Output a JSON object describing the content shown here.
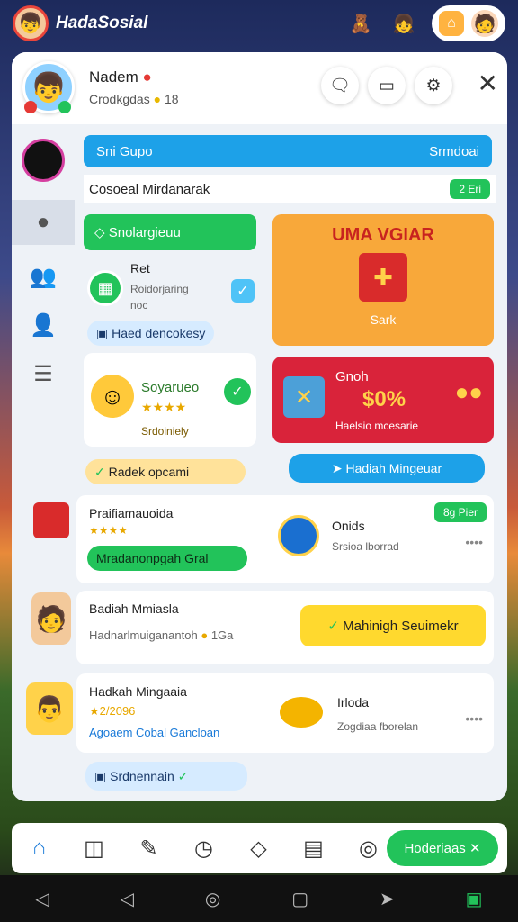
{
  "app": {
    "title": "HadaSosial"
  },
  "profile": {
    "name": "Nadem",
    "subtitle": "Crodkgdas",
    "coins": "18"
  },
  "sections": {
    "group_left": "Sni Gupo",
    "group_right": "Srmdoai",
    "community": "Cosoeal Mirdanarak",
    "community_badge": "2 Eri",
    "green_header": "Snolargieuu",
    "item_title": "Ret",
    "item_sub": "Roidorjaring",
    "item_sub2": "noc",
    "claim_btn": "Haed dencokesy",
    "card_orange_title": "UMA VGIAR",
    "card_orange_label": "Sark",
    "smile_title": "Soyarueo",
    "smile_sub": "Srdoiniely",
    "red_title": "Gnoh",
    "red_percent": "$0%",
    "red_sub": "Haelsio mcesarie",
    "hadiah_pill": "Radek opcami",
    "hadiah_btn": "Hadiah Mingeuar"
  },
  "list": [
    {
      "title": "Praifiamauoida",
      "stars": "★★★★",
      "action": "Mradanonpgah Gral",
      "right_title": "Onids",
      "right_sub": "Srsioa lborrad",
      "chip": "8g Pier"
    },
    {
      "title": "Badiah Mmiasla",
      "sub": "Hadnarlmuiganantoh",
      "coins": "1Ga",
      "cta": "Mahinigh Seuimekr"
    },
    {
      "title": "Hadkah Mingaaia",
      "stars": "★2/2096",
      "link": "Agoaem Cobal Gancloan",
      "right_title": "Irloda",
      "right_sub": "Zogdiaa fborelan"
    }
  ],
  "footer_pill": "Srdnennain",
  "nav": {
    "green_btn": "Hoderiaas ✕"
  }
}
